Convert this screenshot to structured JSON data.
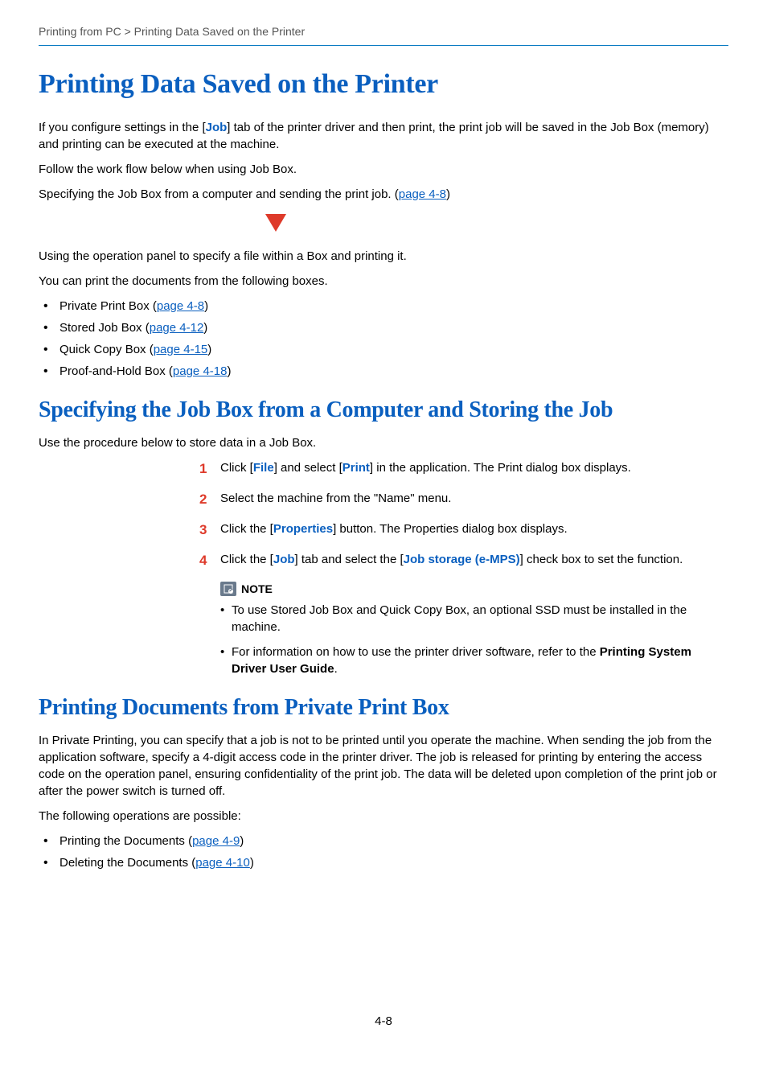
{
  "breadcrumb": "Printing from PC > Printing Data Saved on the Printer",
  "h1": "Printing Data Saved on the Printer",
  "intro": {
    "p1a": "If you configure settings in the [",
    "p1_job": "Job",
    "p1b": "] tab of the printer driver and then print, the print job will be saved in the Job Box (memory) and printing can be executed at the machine.",
    "p2": "Follow the work flow below when using Job Box.",
    "p3a": "Specifying the Job Box from a computer and sending the print job. (",
    "p3_link": "page 4-8",
    "p3b": ")",
    "p4": "Using the operation panel to specify a file within a Box and printing it.",
    "p5": "You can print the documents from the following boxes."
  },
  "box_list": [
    {
      "label": "Private Print Box (",
      "link": "page 4-8",
      "close": ")"
    },
    {
      "label": "Stored Job Box (",
      "link": "page 4-12",
      "close": ")"
    },
    {
      "label": "Quick Copy Box (",
      "link": "page 4-15",
      "close": ")"
    },
    {
      "label": "Proof-and-Hold Box (",
      "link": "page 4-18",
      "close": ")"
    }
  ],
  "h2_spec": "Specifying the Job Box from a Computer and Storing the Job",
  "spec_intro": "Use the procedure below to store data in a Job Box.",
  "steps": {
    "s1a": "Click [",
    "s1_file": "File",
    "s1b": "] and select [",
    "s1_print": "Print",
    "s1c": "] in the application. The Print dialog box displays.",
    "s2": "Select the machine from the \"Name\" menu.",
    "s3a": "Click the [",
    "s3_prop": "Properties",
    "s3b": "] button. The Properties dialog box displays.",
    "s4a": "Click the [",
    "s4_job": "Job",
    "s4b": "] tab and select the [",
    "s4_storage": "Job storage (e-MPS)",
    "s4c": "] check box to set the function."
  },
  "note": {
    "label": "NOTE",
    "n1": "To use Stored Job Box and Quick Copy Box, an optional SSD must be installed in the machine.",
    "n2a": "For information on how to use the printer driver software, refer to the ",
    "n2b": "Printing System Driver User Guide",
    "n2c": "."
  },
  "h2_priv": "Printing Documents from Private Print Box",
  "priv_p1": "In Private Printing, you can specify that a job is not to be printed until you operate the machine. When sending the job from the application software, specify a 4-digit access code in the printer driver. The job is released for printing by entering the access code on the operation panel, ensuring confidentiality of the print job. The data will be deleted upon completion of the print job or after the power switch is turned off.",
  "priv_p2": "The following operations are possible:",
  "priv_list": [
    {
      "label": "Printing the Documents (",
      "link": "page 4-9",
      "close": ")"
    },
    {
      "label": "Deleting the Documents (",
      "link": "page 4-10",
      "close": ")"
    }
  ],
  "page_num": "4-8"
}
